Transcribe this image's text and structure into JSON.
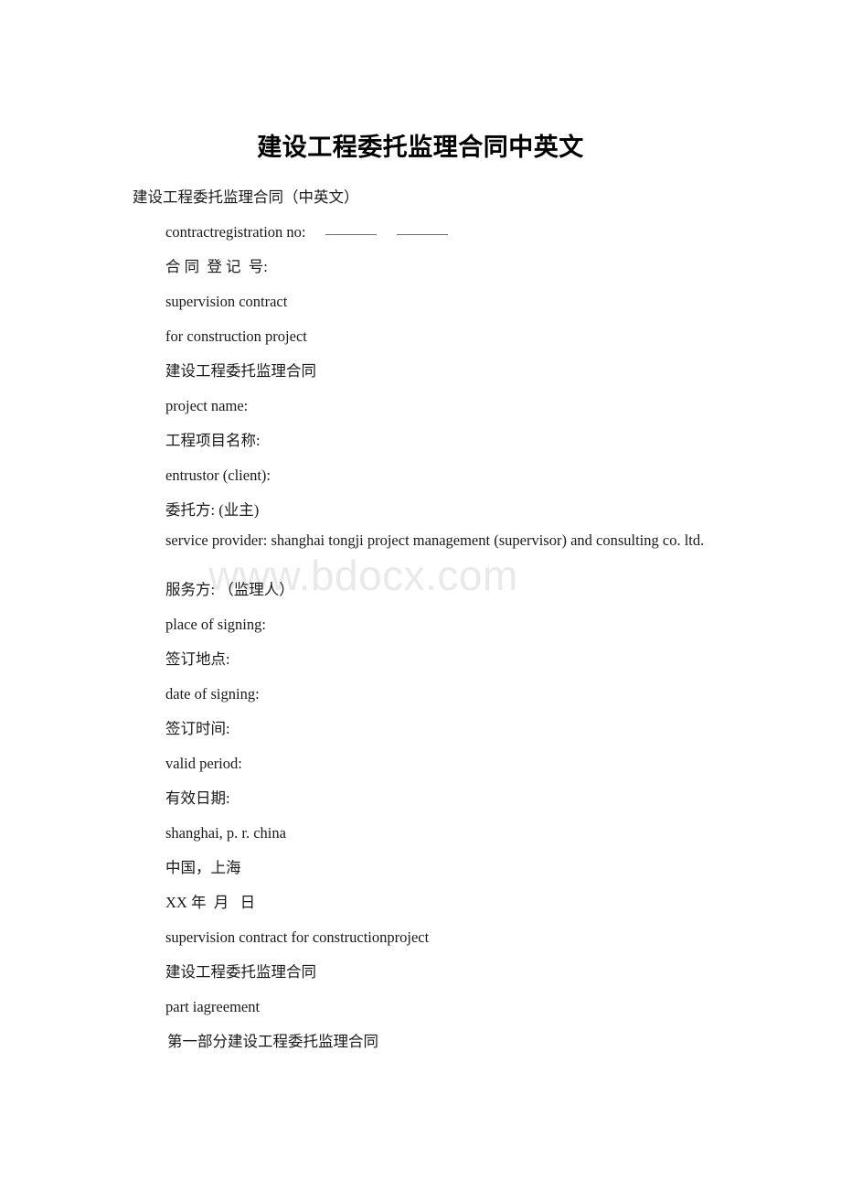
{
  "document": {
    "title": "建设工程委托监理合同中英文",
    "watermark": "www.bdocx.com",
    "watermark_color": "#e9e9e9",
    "text_color": "#1a1a1a",
    "background_color": "#ffffff",
    "lines": [
      {
        "text": "建设工程委托监理合同（中英文）",
        "indent": "ind-1"
      },
      {
        "text": "合 同  登 记  号:",
        "indent": "ind-2"
      },
      {
        "text": "supervision contract",
        "indent": "ind-2"
      },
      {
        "text": "for construction project",
        "indent": "ind-2"
      },
      {
        "text": "建设工程委托监理合同",
        "indent": "ind-2"
      },
      {
        "text": "project name:",
        "indent": "ind-2"
      },
      {
        "text": "工程项目名称:",
        "indent": "ind-2"
      },
      {
        "text": "entrustor (client):",
        "indent": "ind-2"
      },
      {
        "text": "委托方: (业主)",
        "indent": "ind-2"
      },
      {
        "text": "服务方: （监理人）",
        "indent": "ind-2"
      },
      {
        "text": "place of signing:",
        "indent": "ind-2"
      },
      {
        "text": "签订地点:",
        "indent": "ind-2"
      },
      {
        "text": "date of signing:",
        "indent": "ind-2"
      },
      {
        "text": "签订时间:",
        "indent": "ind-2"
      },
      {
        "text": "valid period:",
        "indent": "ind-2"
      },
      {
        "text": "有效日期:",
        "indent": "ind-2"
      },
      {
        "text": "shanghai, p. r. china",
        "indent": "ind-2"
      },
      {
        "text": "中国，上海",
        "indent": "ind-2"
      },
      {
        "text": "XX 年  月   日",
        "indent": "ind-2"
      },
      {
        "text": "supervision contract for constructionproject",
        "indent": "ind-2"
      },
      {
        "text": "建设工程委托监理合同",
        "indent": "ind-2"
      },
      {
        "text": "part iagreement",
        "indent": "ind-2"
      },
      {
        "text": "第一部分建设工程委托监理合同",
        "indent": "ind-3"
      }
    ],
    "registration_line": {
      "label": "contractregistration no:",
      "blank_1": "______",
      "blank_2": "_____"
    },
    "service_provider_paragraph": "service provider: shanghai tongji project management        (supervisor)        and consulting co. ltd."
  }
}
